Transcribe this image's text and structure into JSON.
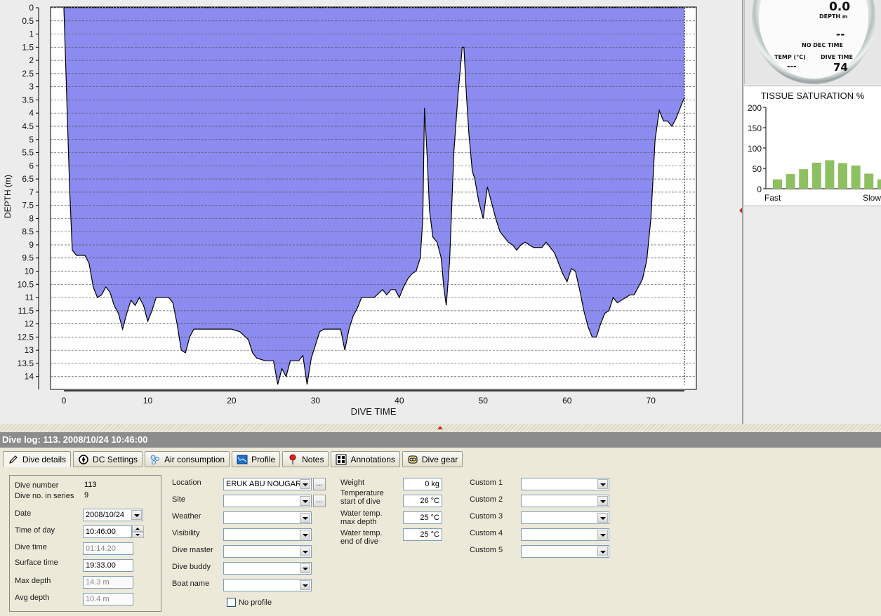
{
  "colors": {
    "profile_fill": "#8b8bf0",
    "tissue_bar": "#8dc060",
    "header_bg": "#8c8c8c"
  },
  "chart_data": [
    {
      "type": "area",
      "xlabel": "DIVE TIME",
      "ylabel": "DEPTH (m)",
      "xlim": [
        0,
        74
      ],
      "ylim": [
        0,
        14.3
      ],
      "y_inverted": true,
      "x_ticks": [
        0,
        10,
        20,
        30,
        40,
        50,
        60,
        70
      ],
      "y_ticks": [
        "0",
        "0.5",
        "1",
        "1.5",
        "2",
        "2.5",
        "3",
        "3.5",
        "4",
        "4.5",
        "5",
        "5.5",
        "6",
        "6.5",
        "7",
        "7.5",
        "8",
        "8.5",
        "9",
        "9.5",
        "10",
        "10.5",
        "11",
        "11.5",
        "12",
        "12.5",
        "13",
        "13.5",
        "14"
      ],
      "grid": "horizontal-dashed",
      "series": [
        {
          "x": [
            0,
            0.2,
            0.4,
            0.7,
            1,
            1.5,
            2,
            2.5,
            3,
            3.5,
            4,
            4.5,
            5,
            5.5,
            6,
            6.5,
            7,
            7.5,
            8,
            8.5,
            9,
            9.5,
            10,
            10.5,
            11,
            11.5,
            12,
            12.5,
            13,
            13.5,
            14,
            14.5,
            15,
            15.5,
            16,
            17,
            18,
            19,
            20,
            21,
            22,
            22.5,
            23,
            24,
            25,
            25.5,
            26,
            26.5,
            27,
            27.5,
            28,
            28.5,
            29,
            29.5,
            30,
            30.5,
            31,
            32,
            33,
            33.5,
            34,
            34.5,
            35,
            35.5,
            36,
            37,
            38,
            38.5,
            39,
            39.5,
            40,
            40.5,
            41,
            41.5,
            42,
            42.5,
            42.8,
            43,
            43.3,
            43.6,
            44,
            44.5,
            45,
            45.3,
            45.6,
            46,
            46.5,
            47,
            47.5,
            47.7,
            48,
            48.3,
            48.7,
            49,
            49.5,
            50,
            50.5,
            51,
            51.5,
            52,
            52.5,
            53,
            53.5,
            54,
            54.5,
            55,
            56,
            57,
            57.5,
            58,
            58.5,
            59,
            59.5,
            60,
            60.5,
            61,
            61.5,
            62,
            62.5,
            63,
            63.5,
            64,
            64.5,
            65,
            65.5,
            66,
            66.5,
            67,
            67.5,
            68,
            68.5,
            69,
            69.5,
            70,
            70.5,
            71,
            71.5,
            72,
            72.5,
            73,
            73.5,
            74
          ],
          "y": [
            0,
            2,
            4,
            7,
            9.2,
            9.4,
            9.4,
            9.4,
            9.7,
            10.6,
            11,
            10.9,
            10.6,
            10.8,
            11.3,
            11.6,
            12.2,
            11.6,
            11.1,
            11.3,
            11,
            11.3,
            11.9,
            11.5,
            11,
            11,
            11,
            11,
            11.2,
            12,
            13,
            13.1,
            12.5,
            12.2,
            12.2,
            12.2,
            12.2,
            12.2,
            12.2,
            12.3,
            12.6,
            13.1,
            13.3,
            13.4,
            13.4,
            14.3,
            13.7,
            14,
            13.4,
            13.4,
            13.4,
            13.2,
            14.3,
            13.3,
            12.8,
            12.3,
            12.2,
            12.2,
            12.2,
            13,
            12.2,
            11.7,
            11.4,
            11,
            11,
            11,
            10.7,
            10.9,
            10.7,
            10.7,
            11,
            10.6,
            10.3,
            10.1,
            10,
            9.5,
            8,
            3.8,
            5.5,
            7.7,
            8.7,
            8.9,
            9.5,
            10.6,
            11.3,
            9.6,
            5.5,
            3.3,
            1.5,
            1.5,
            3.3,
            4.8,
            6.2,
            6.5,
            7.4,
            8,
            6.8,
            7.4,
            8,
            8.5,
            8.7,
            8.9,
            9,
            9.2,
            9,
            8.9,
            9.1,
            9.1,
            8.9,
            9.1,
            9.3,
            9.7,
            10.1,
            10.4,
            9.9,
            10,
            10.7,
            11.5,
            12.1,
            12.5,
            12.5,
            12,
            11.6,
            11.5,
            11,
            11.2,
            11.1,
            11,
            10.9,
            10.9,
            10.6,
            10.3,
            9.6,
            8,
            5,
            3.9,
            4.3,
            4.3,
            4.5,
            4.2,
            3.8,
            3.4
          ]
        }
      ]
    },
    {
      "type": "bar",
      "title": "TISSUE SATURATION %",
      "ylim": [
        0,
        200
      ],
      "y_ticks": [
        "0",
        "50",
        "100",
        "150",
        "200"
      ],
      "xlabel_left": "Fast",
      "xlabel_right": "Slow",
      "values": [
        23,
        36,
        48,
        64,
        70,
        63,
        57,
        37,
        23
      ]
    }
  ],
  "gauge": {
    "depth_value": "0.0",
    "depth_label": "DEPTH",
    "depth_unit": "m",
    "dec_value": "--",
    "dec_label": "NO DEC TIME",
    "temp_label": "TEMP (°C)",
    "temp_value": "---",
    "dive_time_label": "DIVE TIME",
    "dive_time_value": "74"
  },
  "header": {
    "title": "Dive log: 113. 2008/10/24 10:46:00"
  },
  "tabs": [
    {
      "label": "Dive details",
      "icon": "pencil-icon"
    },
    {
      "label": "DC Settings",
      "icon": "dive-computer-icon"
    },
    {
      "label": "Air consumption",
      "icon": "bubbles-icon"
    },
    {
      "label": "Profile",
      "icon": "profile-icon"
    },
    {
      "label": "Notes",
      "icon": "pin-icon"
    },
    {
      "label": "Annotations",
      "icon": "annotations-icon"
    },
    {
      "label": "Dive gear",
      "icon": "dive-gear-icon"
    }
  ],
  "details": {
    "dive_number_label": "Dive number",
    "dive_number": "113",
    "series_label": "Dive no. in series",
    "series": "9",
    "date_label": "Date",
    "date": "2008/10/24",
    "time_label": "Time of day",
    "time": "10:46:00",
    "dive_time_label": "Dive time",
    "dive_time": "01:14.20",
    "surface_time_label": "Surface time",
    "surface_time": "19:33.00",
    "max_depth_label": "Max depth",
    "max_depth": "14.3 m",
    "avg_depth_label": "Avg depth",
    "avg_depth": "10.4 m"
  },
  "location": {
    "location_label": "Location",
    "location": "ERUK ABU NOUGAR",
    "site_label": "Site",
    "site": "",
    "weather_label": "Weather",
    "weather": "",
    "visibility_label": "Visibility",
    "visibility": "",
    "dive_master_label": "Dive master",
    "dive_master": "",
    "dive_buddy_label": "Dive buddy",
    "dive_buddy": "",
    "boat_name_label": "Boat name",
    "boat_name": "",
    "no_profile_label": "No profile"
  },
  "conditions": {
    "weight_label": "Weight",
    "weight": "0 kg",
    "temp_start_label_1": "Temperature",
    "temp_start_label_2": "start of dive",
    "temp_start": "26 °C",
    "temp_max_label_1": "Water temp.",
    "temp_max_label_2": "max depth",
    "temp_max": "25 °C",
    "temp_end_label_1": "Water temp.",
    "temp_end_label_2": "end of dive",
    "temp_end": "25 °C"
  },
  "custom": {
    "c1_label": "Custom 1",
    "c1": "",
    "c2_label": "Custom 2",
    "c2": "",
    "c3_label": "Custom 3",
    "c3": "",
    "c4_label": "Custom 4",
    "c4": "",
    "c5_label": "Custom 5",
    "c5": ""
  }
}
